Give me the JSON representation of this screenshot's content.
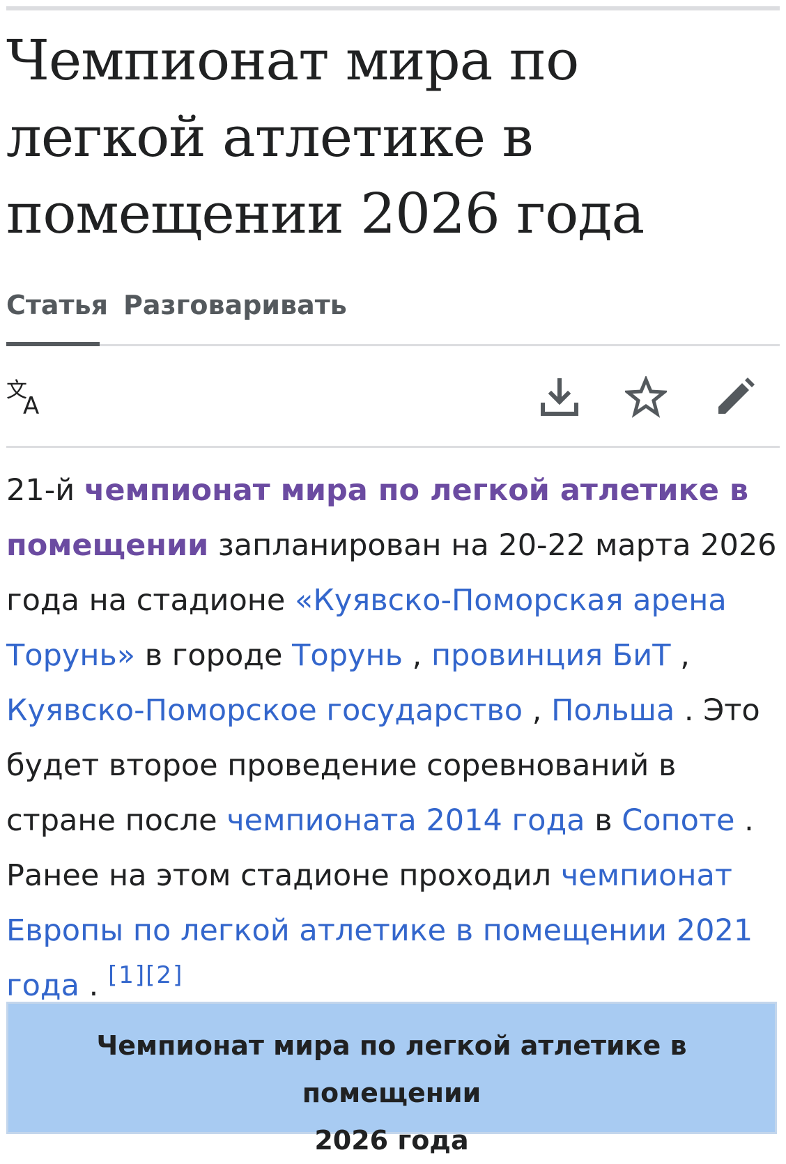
{
  "page": {
    "title": "Чемпионат мира по легкой атлетике в помещении 2026 года"
  },
  "tabs": [
    {
      "label": "Статья",
      "active": true
    },
    {
      "label": "Разговаривать",
      "active": false
    }
  ],
  "toolbar": {
    "language_icon": "translate-icon",
    "download_icon": "download-icon",
    "watch_icon": "star-icon",
    "edit_icon": "pencil-icon"
  },
  "article": {
    "t1": "21-й ",
    "l1": "чемпионат мира по легкой атлетике в помещении",
    "t2": " запланирован на 20-22 марта 2026 года на стадионе ",
    "l2": "«Куявско-Поморская арена Торунь»",
    "t3": " в городе ",
    "l3": "Торунь",
    "t4": " , ",
    "l4": "провинция БиТ",
    "t5": " , ",
    "l5": "Куявско-Поморское государство",
    "t6": " , ",
    "l6": "Польша",
    "t7": " . Это будет второе проведение соревнований в стране после ",
    "l7": "чемпионата 2014 года",
    "t8": " в ",
    "l8": "Сопоте",
    "t9": " . Ранее на этом стадионе проходил ",
    "l9": "чемпионат Европы по легкой атлетике в помещении 2021 года",
    "t10": " . ",
    "ref1": "[1]",
    "ref2": "[2]"
  },
  "infobox": {
    "title_line1": "Чемпионат мира по легкой атлетике в помещении",
    "title_line2": "2026 года"
  },
  "colors": {
    "link": "#3366cc",
    "visited_link": "#6b4ba1",
    "infobox_bg": "#a8cbf2"
  }
}
